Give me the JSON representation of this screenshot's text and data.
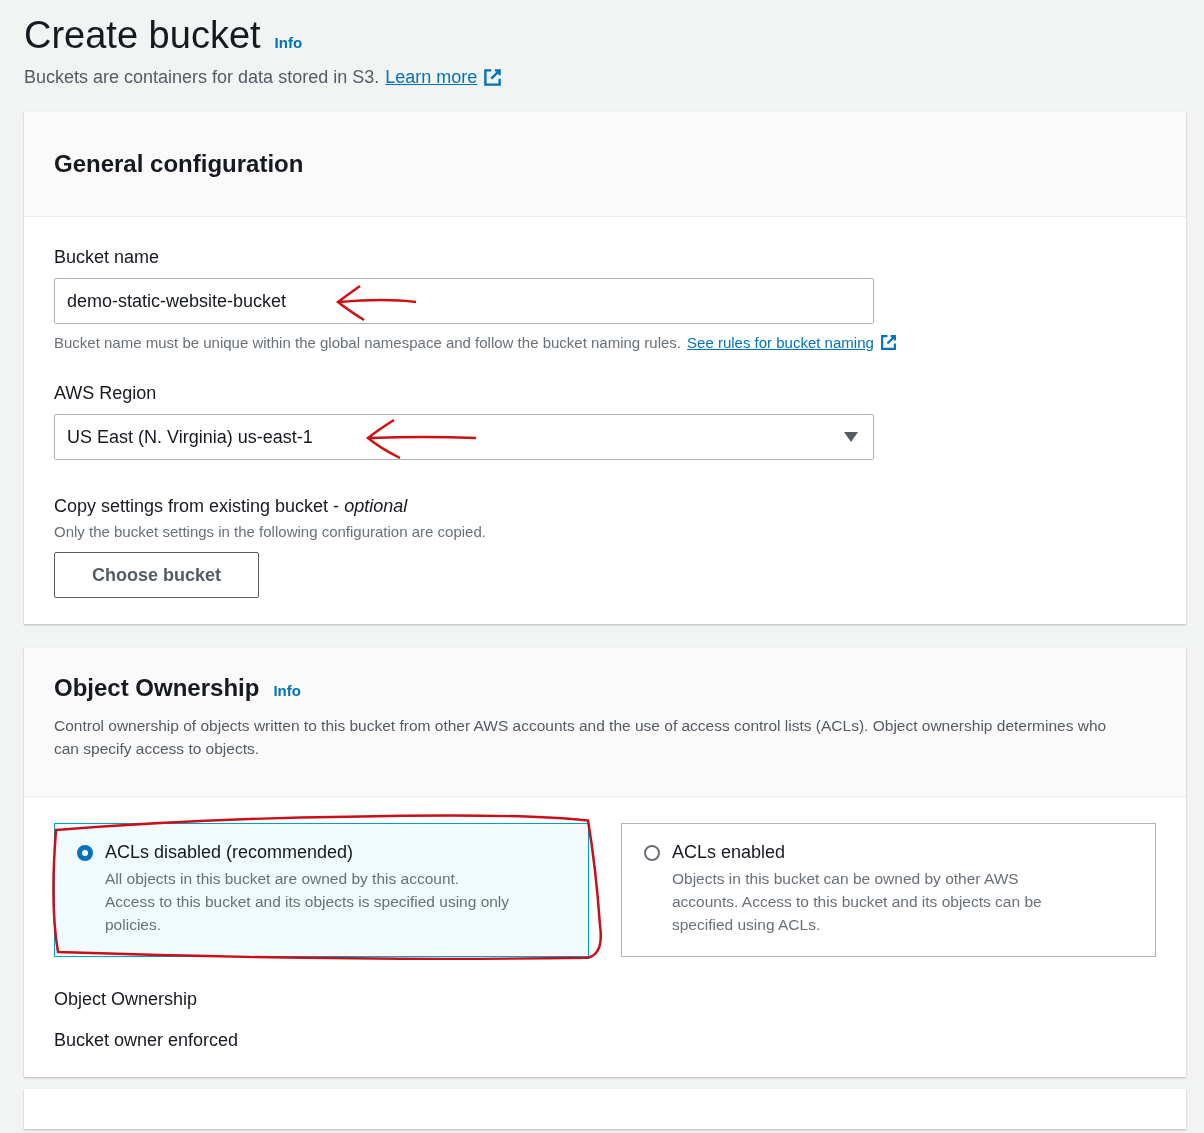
{
  "page": {
    "title": "Create bucket",
    "info": "Info",
    "description": "Buckets are containers for data stored in S3.",
    "learn_more": "Learn more"
  },
  "general": {
    "title": "General configuration",
    "bucket_name": {
      "label": "Bucket name",
      "value": "demo-static-website-bucket",
      "hint": "Bucket name must be unique within the global namespace and follow the bucket naming rules.",
      "hint_link": "See rules for bucket naming"
    },
    "region": {
      "label": "AWS Region",
      "value": "US East (N. Virginia) us-east-1"
    },
    "copy": {
      "label": "Copy settings from existing bucket - *optional*",
      "hint": "Only the bucket settings in the following configuration are copied.",
      "button": "Choose bucket"
    }
  },
  "ownership": {
    "title": "Object Ownership",
    "info": "Info",
    "description": "Control ownership of objects written to this bucket from other AWS accounts and the use of access control lists (ACLs). Object ownership determines who can specify access to objects.",
    "options": [
      {
        "label": "ACLs disabled (recommended)",
        "description": "All objects in this bucket are owned by this account. Access to this bucket and its objects is specified using only policies.",
        "selected": true
      },
      {
        "label": "ACLs enabled",
        "description": "Objects in this bucket can be owned by other AWS accounts. Access to this bucket and its objects can be specified using ACLs.",
        "selected": false
      }
    ],
    "result_label": "Object Ownership",
    "result_value": "Bucket owner enforced"
  }
}
